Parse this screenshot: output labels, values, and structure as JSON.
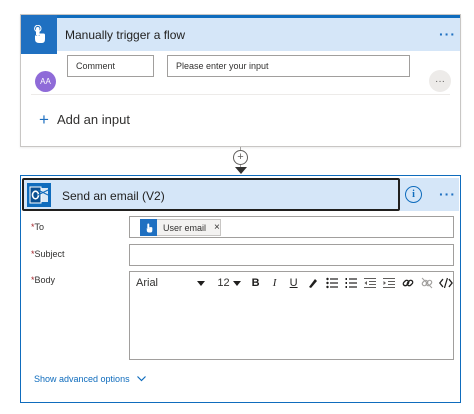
{
  "trigger": {
    "title": "Manually trigger a flow",
    "more_label": "···",
    "avatar_text": "AA",
    "input_name": "Comment",
    "input_placeholder": "Please enter your input",
    "row_more_label": "···",
    "add_input_label": "Add an input"
  },
  "connector": {
    "plus_label": "+"
  },
  "action": {
    "title": "Send an email (V2)",
    "info_label": "i",
    "more_label": "···",
    "fields": {
      "to_label": "To",
      "subject_label": "Subject",
      "body_label": "Body",
      "required_marker": "*"
    },
    "to_token": {
      "label": "User email",
      "remove": "×"
    },
    "editor": {
      "font": "Arial",
      "size": "12",
      "bold": "B",
      "italic": "I",
      "underline": "U"
    },
    "show_advanced": "Show advanced options"
  },
  "colors": {
    "accent": "#0f6cbd",
    "header_bg": "#d5e6f8",
    "trigger_icon": "#1f70c1",
    "avatar": "#8f6bd8",
    "required": "#a4262c"
  },
  "icons": {
    "trigger": "touch-hand-icon",
    "action": "outlook-icon"
  }
}
